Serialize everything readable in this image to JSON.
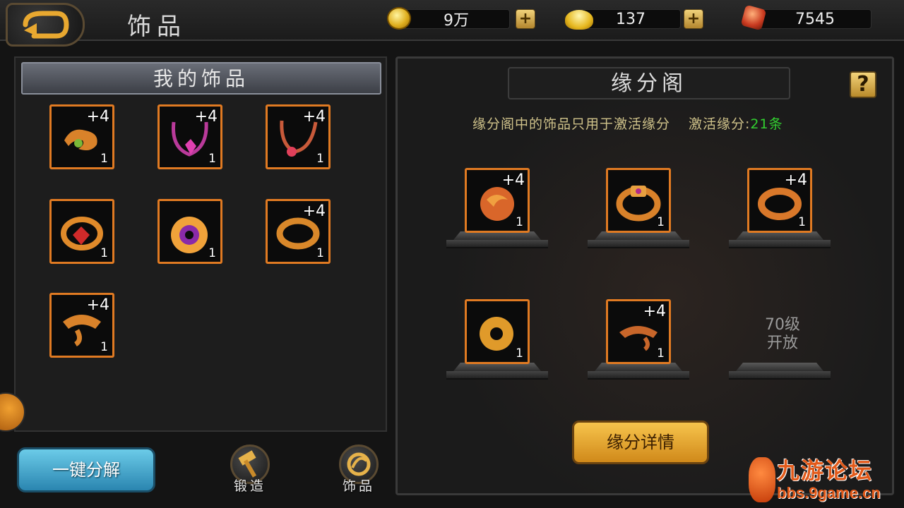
{
  "header": {
    "title": "饰品",
    "currencies": [
      {
        "icon": "gold-coin-icon",
        "value": "9万"
      },
      {
        "icon": "gold-ingot-icon",
        "value": "137"
      },
      {
        "icon": "red-gem-icon",
        "value": "7545"
      }
    ],
    "plus_symbol": "+"
  },
  "my_items": {
    "title": "我的饰品",
    "items": [
      {
        "name": "dragon-ornament",
        "enhance": "+4",
        "qty": "1"
      },
      {
        "name": "purple-necklace",
        "enhance": "+4",
        "qty": "1"
      },
      {
        "name": "ruby-necklace",
        "enhance": "+4",
        "qty": "1"
      },
      {
        "name": "ruby-ring",
        "enhance": "",
        "qty": "1"
      },
      {
        "name": "purple-pendant",
        "enhance": "",
        "qty": "1"
      },
      {
        "name": "gold-coil-ring",
        "enhance": "+4",
        "qty": "1"
      },
      {
        "name": "gold-bracelet",
        "enhance": "+4",
        "qty": "1"
      }
    ]
  },
  "fate_pavilion": {
    "title": "缘分阁",
    "help_label": "?",
    "info_text": "缘分阁中的饰品只用于激活缘分",
    "active_label": "激活缘分:",
    "active_count": "21条",
    "slots": [
      {
        "name": "dragon-ring",
        "enhance": "+4",
        "qty": "1"
      },
      {
        "name": "jeweled-ring",
        "enhance": "",
        "qty": "1"
      },
      {
        "name": "twist-ring",
        "enhance": "+4",
        "qty": "1"
      },
      {
        "name": "gold-disc-pendant",
        "enhance": "",
        "qty": "1"
      },
      {
        "name": "snake-bracelet",
        "enhance": "+4",
        "qty": "1"
      }
    ],
    "locked_slot_line1": "70级",
    "locked_slot_line2": "开放",
    "detail_button": "缘分详情"
  },
  "bottom": {
    "decompose_button": "一键分解",
    "forge_label": "锻造",
    "ornament_label": "饰品"
  },
  "watermark": {
    "title": "九游论坛",
    "url": "bbs.9game.cn"
  },
  "colors": {
    "tile_border": "#e07a22",
    "active_count": "#32d030",
    "info_text": "#cfc28a"
  }
}
